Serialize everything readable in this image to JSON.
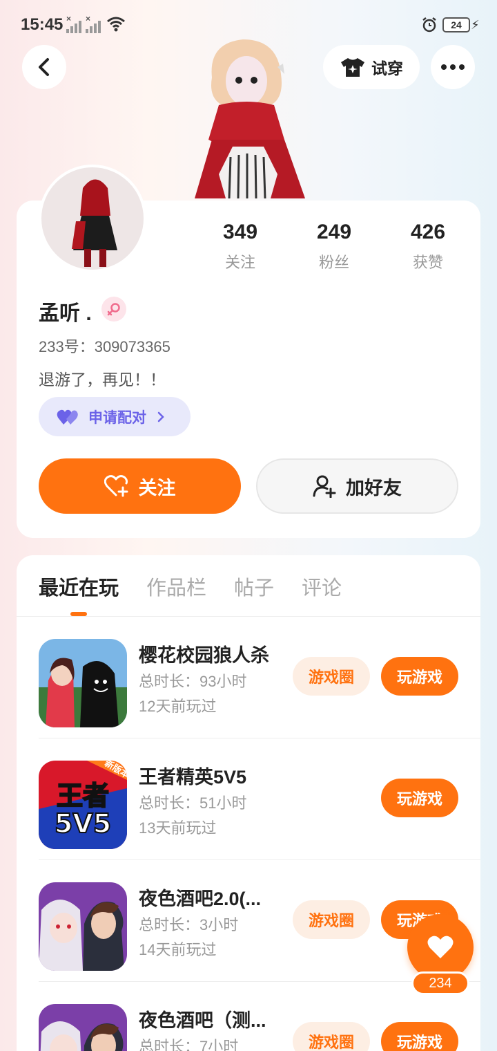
{
  "status_bar": {
    "time": "15:45",
    "battery": "24",
    "icons": [
      "signal-off-icon",
      "signal-off-icon",
      "wifi-icon",
      "alarm-icon",
      "battery-icon",
      "charging-icon"
    ]
  },
  "header": {
    "back_icon": "chevron-left-icon",
    "tryon_label": "试穿",
    "tryon_icon": "tshirt-icon",
    "more_icon": "more-dots-icon"
  },
  "profile": {
    "stats": [
      {
        "value": "349",
        "label": "关注"
      },
      {
        "value": "249",
        "label": "粉丝"
      },
      {
        "value": "426",
        "label": "获赞"
      }
    ],
    "nickname": "孟听 .",
    "gender_icon": "female-icon",
    "uid": "233号：309073365",
    "bio": "退游了，再见！！",
    "pair_label": "申请配对",
    "follow_label": "关注",
    "add_friend_label": "加好友"
  },
  "tabs": [
    {
      "label": "最近在玩",
      "active": true
    },
    {
      "label": "作品栏",
      "active": false
    },
    {
      "label": "帖子",
      "active": false
    },
    {
      "label": "评论",
      "active": false
    }
  ],
  "games": [
    {
      "name": "樱花校园狼人杀",
      "duration": "总时长：93小时",
      "last_played": "12天前玩过",
      "circle_label": "游戏圈",
      "play_label": "玩游戏"
    },
    {
      "name": "王者精英5V5",
      "duration": "总时长：51小时",
      "last_played": "13天前玩过",
      "play_label": "玩游戏",
      "icon_text": "王者",
      "icon_text2": "5V5",
      "icon_badge": "新版本"
    },
    {
      "name": "夜色酒吧2.0(...",
      "duration": "总时长：3小时",
      "last_played": "14天前玩过",
      "circle_label": "游戏圈",
      "play_label": "玩游戏"
    },
    {
      "name": "夜色酒吧（测...",
      "duration": "总时长：7小时",
      "last_played": "",
      "circle_label": "游戏圈",
      "play_label": "玩游戏"
    }
  ],
  "float_like": {
    "count": "234",
    "icon": "heart-icon"
  },
  "colors": {
    "accent": "#ff7210",
    "pair": "#6b62e8"
  }
}
